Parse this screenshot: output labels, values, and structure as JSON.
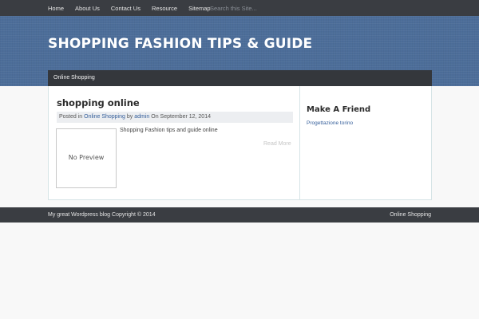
{
  "nav": {
    "items": [
      {
        "label": "Home"
      },
      {
        "label": "About Us"
      },
      {
        "label": "Contact Us"
      },
      {
        "label": "Resource"
      },
      {
        "label": "Sitemap"
      }
    ],
    "search_placeholder": "Search this Site..."
  },
  "header": {
    "site_title": "SHOPPING FASHION TIPS & GUIDE"
  },
  "category_bar": {
    "label": "Online Shopping"
  },
  "post": {
    "title": "shopping online",
    "meta": {
      "posted_in": "Posted in",
      "category": "Online Shopping",
      "by": "by",
      "author": "admin",
      "on": "On",
      "date": "September 12, 2014"
    },
    "thumbnail_text": "No Preview",
    "excerpt": "Shopping Fashion tips and guide online",
    "read_more": "Read More"
  },
  "sidebar": {
    "widget_title": "Make A Friend",
    "link": "Progettazione torino"
  },
  "footer": {
    "copyright": "My great Wordpress blog Copyright © 2014",
    "link": "Online Shopping"
  },
  "colors": {
    "topbar": "#3a3d42",
    "banner": "#4c6d99",
    "link": "#355f9b"
  }
}
